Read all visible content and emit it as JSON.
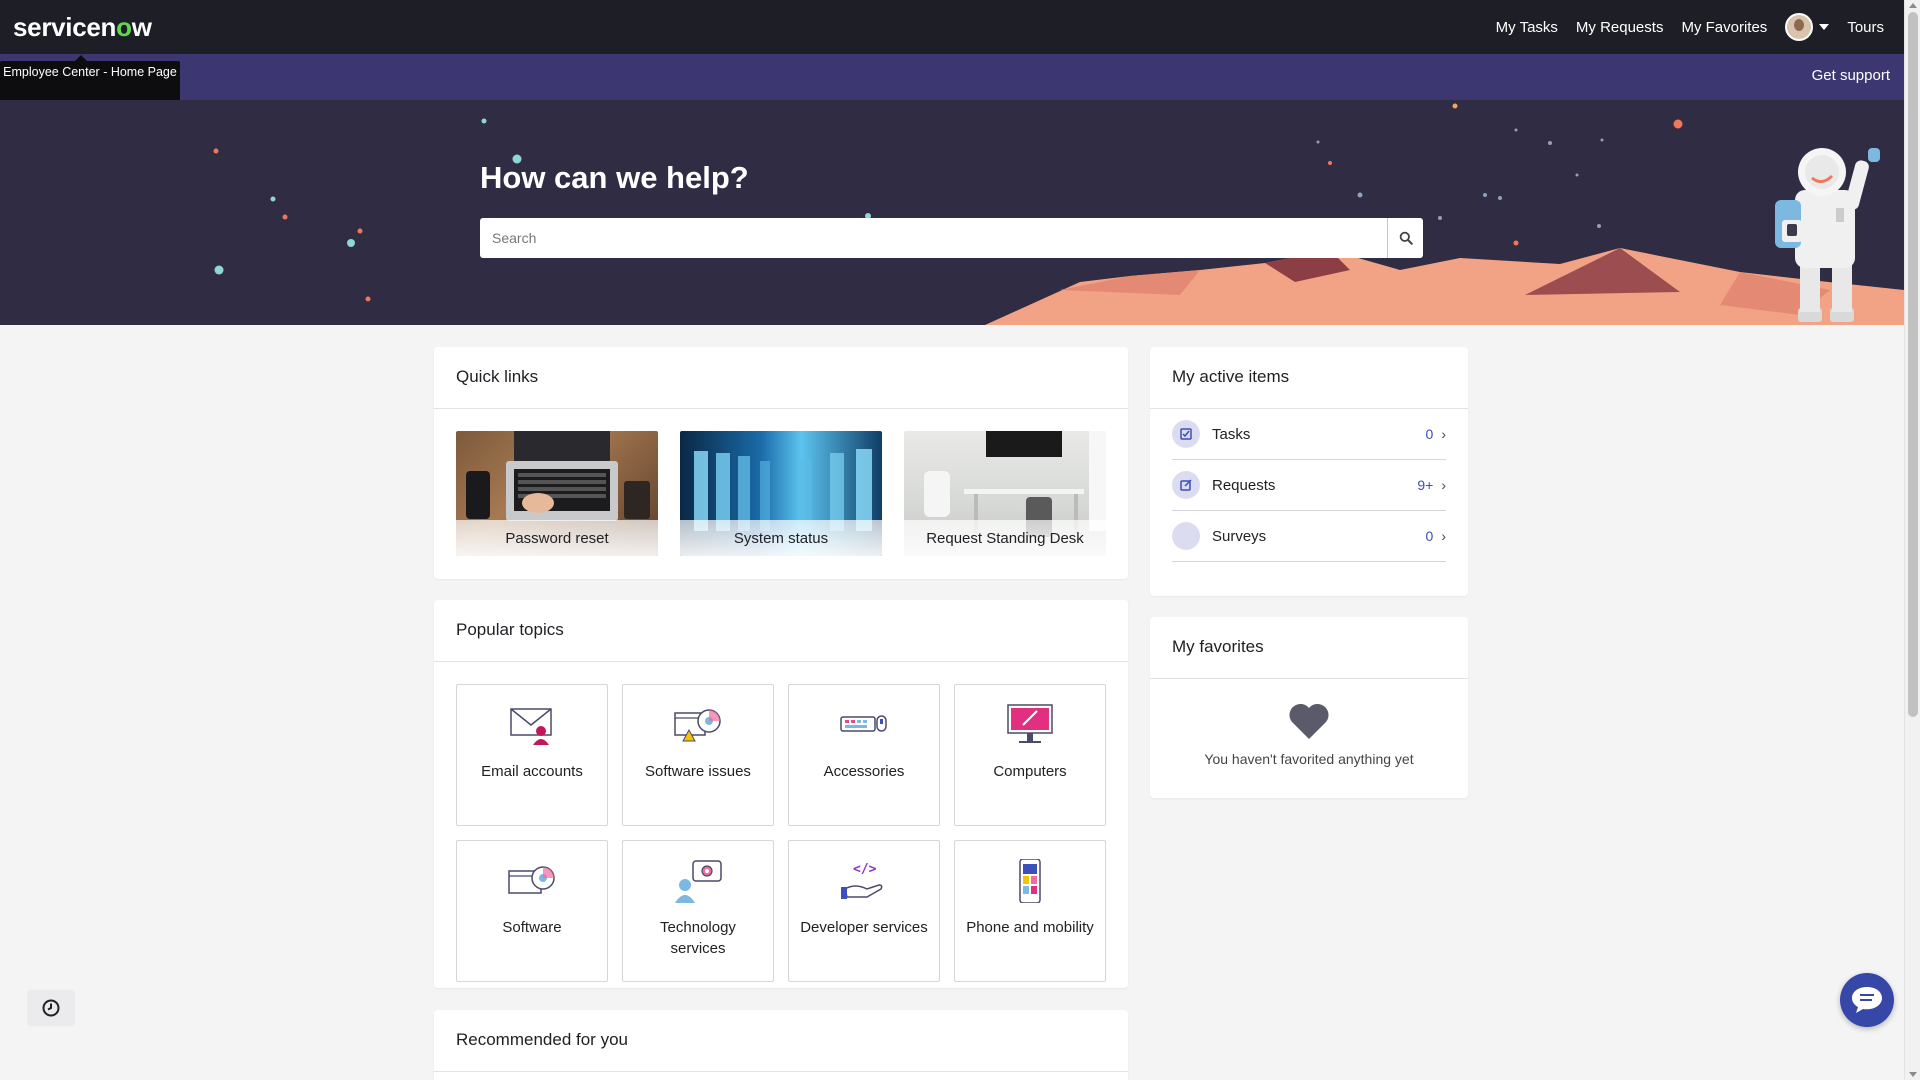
{
  "topbar": {
    "logo_prefix": "servicen",
    "logo_o": "o",
    "logo_suffix": "w",
    "nav": [
      "My Tasks",
      "My Requests",
      "My Favorites",
      "Tours"
    ]
  },
  "tooltip": "Employee Center - Home Page",
  "strip": {
    "get_support": "Get support"
  },
  "hero": {
    "title": "How can we help?",
    "search_placeholder": "Search",
    "search_value": ""
  },
  "quick_links": {
    "title": "Quick links",
    "items": [
      {
        "label": "Password reset"
      },
      {
        "label": "System status"
      },
      {
        "label": "Request Standing Desk"
      }
    ]
  },
  "popular_topics": {
    "title": "Popular topics",
    "items": [
      {
        "label": "Email accounts",
        "icon": "email-icon"
      },
      {
        "label": "Software issues",
        "icon": "software-issues-icon"
      },
      {
        "label": "Accessories",
        "icon": "keyboard-mouse-icon"
      },
      {
        "label": "Computers",
        "icon": "monitor-icon"
      },
      {
        "label": "Software",
        "icon": "software-disc-icon"
      },
      {
        "label": "Technology services",
        "icon": "technology-services-icon"
      },
      {
        "label": "Developer services",
        "icon": "code-hand-icon"
      },
      {
        "label": "Phone and mobility",
        "icon": "phone-icon"
      }
    ]
  },
  "recommended": {
    "title": "Recommended for you"
  },
  "active_items": {
    "title": "My active items",
    "rows": [
      {
        "label": "Tasks",
        "count": "0"
      },
      {
        "label": "Requests",
        "count": "9+"
      },
      {
        "label": "Surveys",
        "count": "0"
      }
    ]
  },
  "favorites": {
    "title": "My favorites",
    "empty_message": "You haven't favorited anything yet"
  },
  "colors": {
    "topbar": "#1e1e26",
    "strip": "#3d3771",
    "hero": "#302c44",
    "accent": "#3d4fb8",
    "logo_o": "#62d84e"
  }
}
